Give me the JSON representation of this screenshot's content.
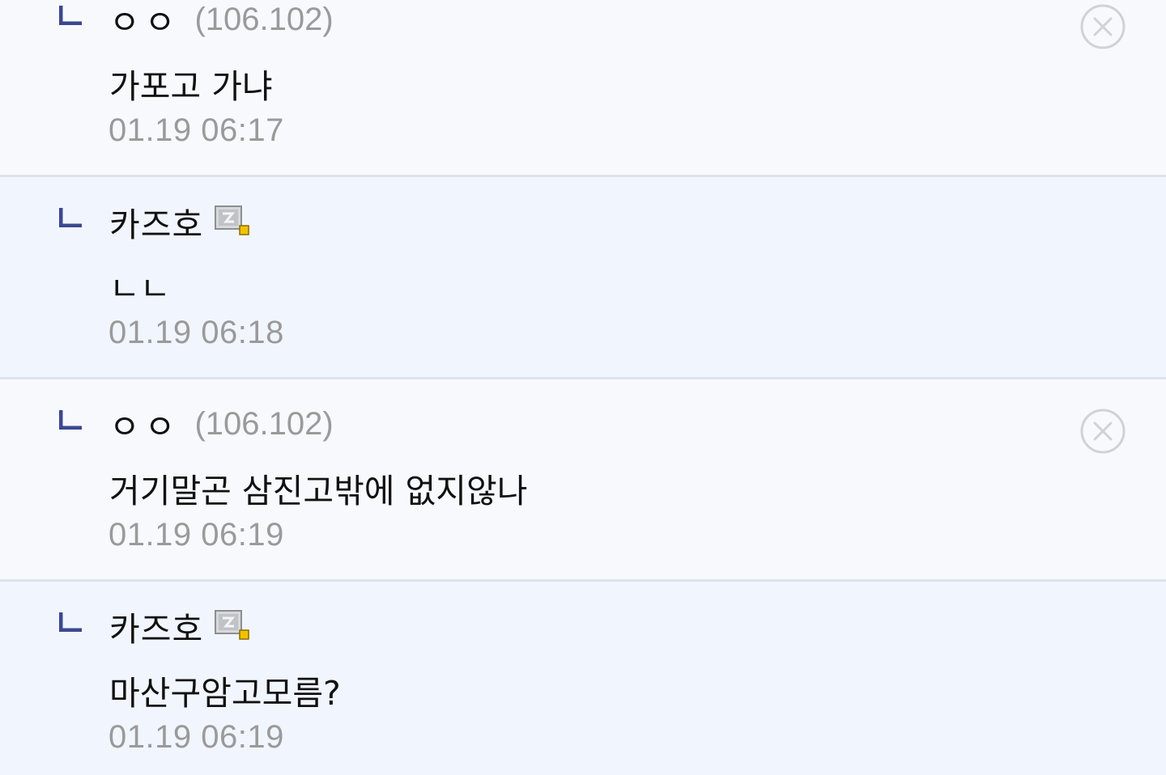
{
  "comments": [
    {
      "type": "guest",
      "nickname": "ㅇㅇ",
      "ip": "(106.102)",
      "text": "가포고 가냐",
      "time": "01.19 06:17",
      "deletable": true
    },
    {
      "type": "member",
      "nickname": "카즈호",
      "ip": "",
      "text": "ㄴㄴ",
      "time": "01.19 06:18",
      "deletable": false
    },
    {
      "type": "guest",
      "nickname": "ㅇㅇ",
      "ip": "(106.102)",
      "text": "거기말곤 삼진고밖에 없지않나",
      "time": "01.19 06:19",
      "deletable": true
    },
    {
      "type": "member",
      "nickname": "카즈호",
      "ip": "",
      "text": "마산구암고모름?",
      "time": "01.19 06:19",
      "deletable": false
    }
  ],
  "icons": {
    "reply": "reply-arrow-icon",
    "gallog": "gallog-icon",
    "delete": "close-circle-icon"
  },
  "colors": {
    "guest_bg": "#f8f9fc",
    "member_bg": "#f1f5fd",
    "divider": "#dde2ec",
    "reply_icon": "#3b4890",
    "meta_text": "#9a9a9a",
    "body_text": "#111111"
  }
}
